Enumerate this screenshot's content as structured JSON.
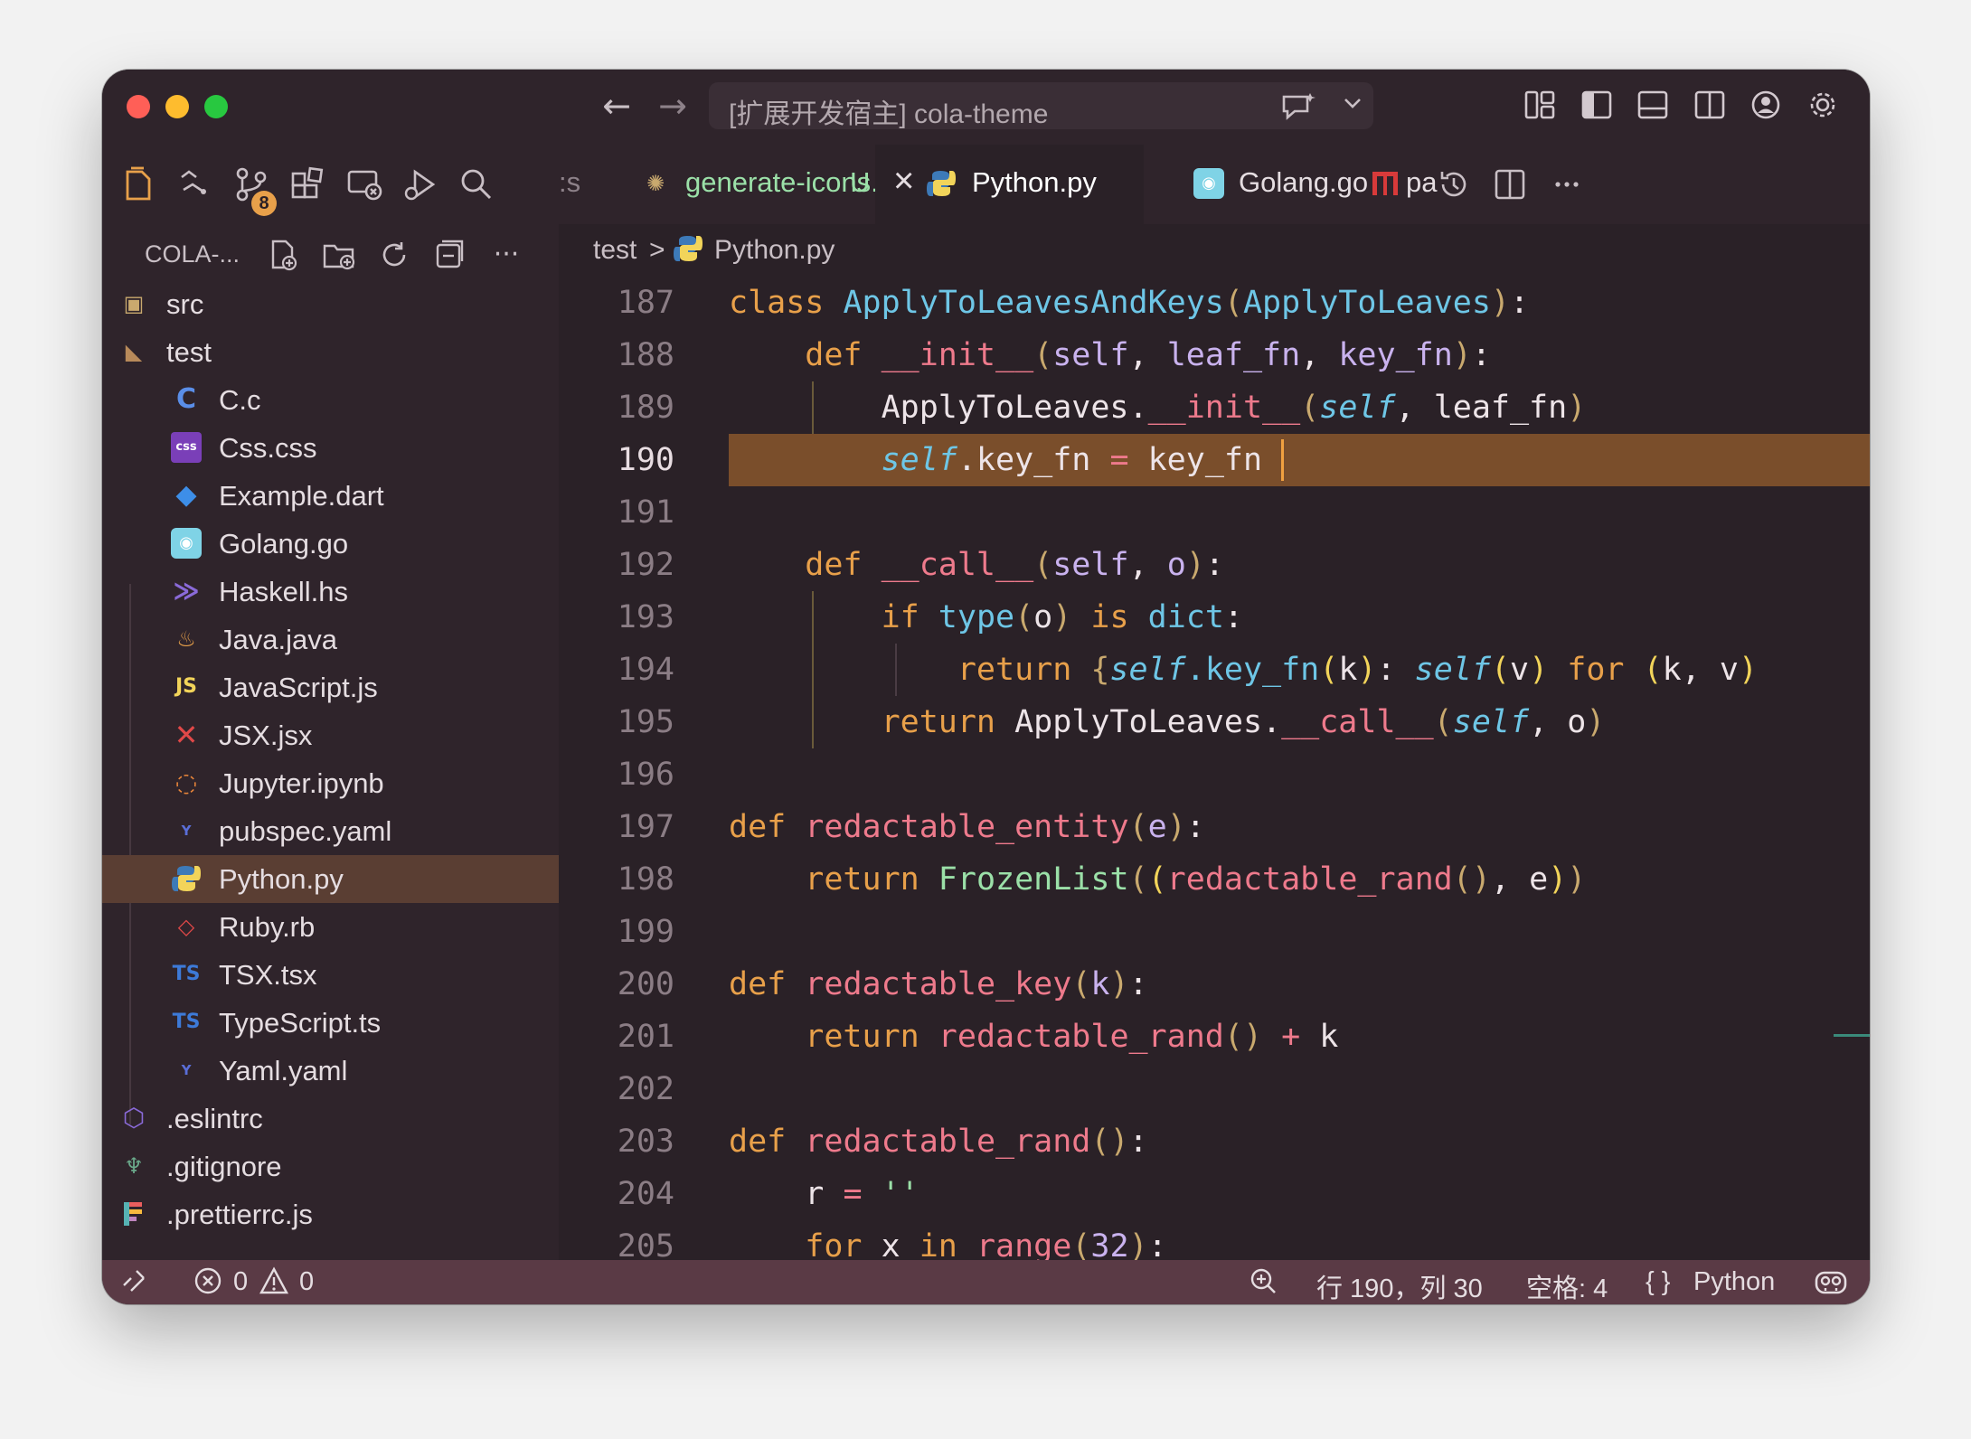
{
  "window": {
    "command_center": "[扩展开发宿主] cola-theme",
    "nav_back": "←",
    "nav_forward": "→"
  },
  "activity": {
    "scm_badge": "8"
  },
  "tabs": [
    {
      "label": ":s"
    },
    {
      "label": "generate-icons.sh",
      "status": "U"
    },
    {
      "label": "Python.py",
      "close": "×"
    },
    {
      "label": "Golang.go"
    },
    {
      "label": "pa"
    }
  ],
  "sidebar": {
    "title": "COLA-...",
    "more": "···",
    "items": [
      {
        "label": "src",
        "icon": "box-icon"
      },
      {
        "label": "test",
        "icon": "test-folder-icon"
      },
      {
        "label": "C.c",
        "icon": "c-icon"
      },
      {
        "label": "Css.css",
        "icon": "css-icon"
      },
      {
        "label": "Example.dart",
        "icon": "dart-icon"
      },
      {
        "label": "Golang.go",
        "icon": "go-icon"
      },
      {
        "label": "Haskell.hs",
        "icon": "haskell-icon"
      },
      {
        "label": "Java.java",
        "icon": "java-icon"
      },
      {
        "label": "JavaScript.js",
        "icon": "js-icon"
      },
      {
        "label": "JSX.jsx",
        "icon": "jsx-icon"
      },
      {
        "label": "Jupyter.ipynb",
        "icon": "jupyter-icon"
      },
      {
        "label": "pubspec.yaml",
        "icon": "yaml-icon"
      },
      {
        "label": "Python.py",
        "icon": "python-icon"
      },
      {
        "label": "Ruby.rb",
        "icon": "ruby-icon"
      },
      {
        "label": "TSX.tsx",
        "icon": "tsx-icon"
      },
      {
        "label": "TypeScript.ts",
        "icon": "ts-icon"
      },
      {
        "label": "Yaml.yaml",
        "icon": "yaml-icon"
      },
      {
        "label": ".eslintrc",
        "icon": "eslint-icon"
      },
      {
        "label": ".gitignore",
        "icon": "git-icon"
      },
      {
        "label": ".prettierrc.js",
        "icon": "prettier-icon"
      }
    ]
  },
  "breadcrumb": {
    "folder": "test",
    "separator": ">",
    "file": "Python.py"
  },
  "code": {
    "lines": [
      {
        "n": "187",
        "tokens": [
          [
            "class ",
            "kw"
          ],
          [
            "ApplyToLeavesAndKeys",
            "cls"
          ],
          [
            "(",
            "p1"
          ],
          [
            "ApplyToLeaves",
            "cls"
          ],
          [
            ")",
            "p1"
          ],
          [
            ":",
            "op"
          ]
        ]
      },
      {
        "n": "188",
        "tokens": [
          [
            "    def ",
            "kw"
          ],
          [
            "__init__",
            "fn"
          ],
          [
            "(",
            "p1"
          ],
          [
            "self",
            "slf"
          ],
          [
            ", ",
            "op"
          ],
          [
            "leaf_fn",
            "par"
          ],
          [
            ", ",
            "op"
          ],
          [
            "key_fn",
            "par"
          ],
          [
            ")",
            "p1"
          ],
          [
            ":",
            "op"
          ]
        ]
      },
      {
        "n": "189",
        "tokens": [
          [
            "        ApplyToLeaves",
            "txt"
          ],
          [
            ".",
            "op"
          ],
          [
            "__init__",
            "fn"
          ],
          [
            "(",
            "p1"
          ],
          [
            "self",
            "sit"
          ],
          [
            ", ",
            "op"
          ],
          [
            "leaf_fn",
            "txt"
          ],
          [
            ")",
            "p1"
          ]
        ]
      },
      {
        "n": "190",
        "tokens": [
          [
            "        ",
            "txt"
          ],
          [
            "self",
            "sit"
          ],
          [
            ".key_fn ",
            "txt"
          ],
          [
            "=",
            "eq"
          ],
          [
            " key_fn ",
            "txt"
          ]
        ]
      },
      {
        "n": "191",
        "tokens": []
      },
      {
        "n": "192",
        "tokens": [
          [
            "    def ",
            "kw"
          ],
          [
            "__call__",
            "fn"
          ],
          [
            "(",
            "p1"
          ],
          [
            "self",
            "slf"
          ],
          [
            ", ",
            "op"
          ],
          [
            "o",
            "par"
          ],
          [
            ")",
            "p1"
          ],
          [
            ":",
            "op"
          ]
        ]
      },
      {
        "n": "193",
        "tokens": [
          [
            "        if ",
            "kw"
          ],
          [
            "type",
            "bi"
          ],
          [
            "(",
            "p1"
          ],
          [
            "o",
            "txt"
          ],
          [
            ")",
            "p1"
          ],
          [
            " is ",
            "kw"
          ],
          [
            "dict",
            "bi"
          ],
          [
            ":",
            "op"
          ]
        ]
      },
      {
        "n": "194",
        "tokens": [
          [
            "            return ",
            "kw"
          ],
          [
            "{",
            "p1"
          ],
          [
            "self",
            "sit"
          ],
          [
            ".key_fn",
            "cls"
          ],
          [
            "(",
            "p2"
          ],
          [
            "k",
            "txt"
          ],
          [
            ")",
            "p2"
          ],
          [
            ": ",
            "op"
          ],
          [
            "self",
            "sit"
          ],
          [
            "(",
            "p2"
          ],
          [
            "v",
            "txt"
          ],
          [
            ")",
            "p2"
          ],
          [
            " for ",
            "kw"
          ],
          [
            "(",
            "p2"
          ],
          [
            "k, v",
            "txt"
          ],
          [
            ")",
            "p2"
          ]
        ]
      },
      {
        "n": "195",
        "tokens": [
          [
            "        return ",
            "kw"
          ],
          [
            "ApplyToLeaves",
            "txt"
          ],
          [
            ".",
            "op"
          ],
          [
            "__call__",
            "fn"
          ],
          [
            "(",
            "p1"
          ],
          [
            "self",
            "sit"
          ],
          [
            ", ",
            "op"
          ],
          [
            "o",
            "txt"
          ],
          [
            ")",
            "p1"
          ]
        ]
      },
      {
        "n": "196",
        "tokens": []
      },
      {
        "n": "197",
        "tokens": [
          [
            "def ",
            "kw"
          ],
          [
            "redactable_entity",
            "fn"
          ],
          [
            "(",
            "p1"
          ],
          [
            "e",
            "par"
          ],
          [
            ")",
            "p1"
          ],
          [
            ":",
            "op"
          ]
        ]
      },
      {
        "n": "198",
        "tokens": [
          [
            "    return ",
            "kw"
          ],
          [
            "FrozenList",
            "cls2"
          ],
          [
            "(",
            "p1"
          ],
          [
            "(",
            "p2"
          ],
          [
            "redactable_rand",
            "fn"
          ],
          [
            "()",
            "p3"
          ],
          [
            ", ",
            "op"
          ],
          [
            "e",
            "txt"
          ],
          [
            ")",
            "p2"
          ],
          [
            ")",
            "p1"
          ]
        ]
      },
      {
        "n": "199",
        "tokens": []
      },
      {
        "n": "200",
        "tokens": [
          [
            "def ",
            "kw"
          ],
          [
            "redactable_key",
            "fn"
          ],
          [
            "(",
            "p1"
          ],
          [
            "k",
            "par"
          ],
          [
            ")",
            "p1"
          ],
          [
            ":",
            "op"
          ]
        ]
      },
      {
        "n": "201",
        "tokens": [
          [
            "    return ",
            "kw"
          ],
          [
            "redactable_rand",
            "fn"
          ],
          [
            "()",
            "p1"
          ],
          [
            " + ",
            "eq"
          ],
          [
            "k",
            "txt"
          ]
        ]
      },
      {
        "n": "202",
        "tokens": []
      },
      {
        "n": "203",
        "tokens": [
          [
            "def ",
            "kw"
          ],
          [
            "redactable_rand",
            "fn"
          ],
          [
            "()",
            "p1"
          ],
          [
            ":",
            "op"
          ]
        ]
      },
      {
        "n": "204",
        "tokens": [
          [
            "    r ",
            "txt"
          ],
          [
            "=",
            "eq"
          ],
          [
            " ",
            "txt"
          ],
          [
            "''",
            "str"
          ]
        ]
      },
      {
        "n": "205",
        "tokens": [
          [
            "    for ",
            "kw"
          ],
          [
            "x ",
            "txt"
          ],
          [
            "in ",
            "kw"
          ],
          [
            "range",
            "fn"
          ],
          [
            "(",
            "p1"
          ],
          [
            "32",
            "num"
          ],
          [
            ")",
            "p1"
          ],
          [
            ":",
            "op"
          ]
        ]
      }
    ],
    "colors": {
      "kw": "#e8a04a",
      "cls": "#6ec6e6",
      "cls2": "#9be0a8",
      "fn": "#ee7a8c",
      "slf": "#c9b2ee",
      "sit": "#6ec6e6",
      "par": "#c9b2ee",
      "txt": "#ede4e8",
      "op": "#ede4e8",
      "eq": "#ee7a8c",
      "bi": "#6ec6e6",
      "p1": "#c9a96e",
      "p2": "#f2d45a",
      "p3": "#c9a96e",
      "str": "#9be0a8",
      "num": "#c9b2ee"
    }
  },
  "status": {
    "errors": "0",
    "warnings": "0",
    "position": "行 190，列 30",
    "spaces": "空格: 4",
    "language_braces": "{ }",
    "language": "Python"
  }
}
